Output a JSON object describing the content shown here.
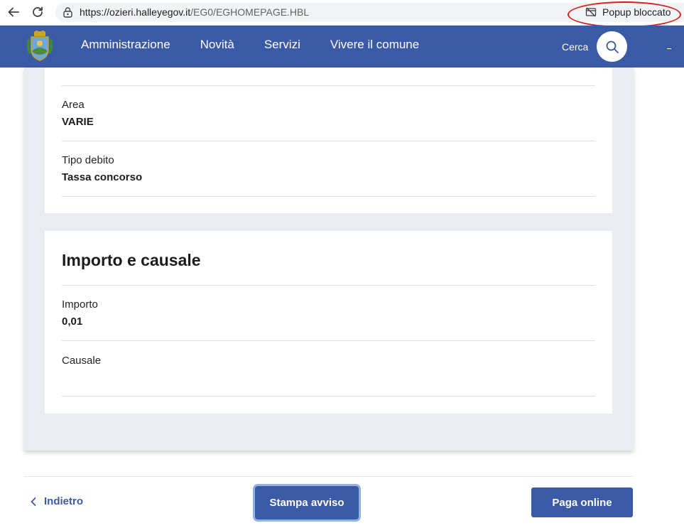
{
  "browser": {
    "url_host": "https://ozieri.halleyegov.it",
    "url_path": "/EG0/EGHOMEPAGE.HBL",
    "popup_blocked_label": "Popup bloccato",
    "icons": [
      "back-arrow-icon",
      "reload-icon",
      "lock-icon",
      "popup-blocked-icon"
    ]
  },
  "header": {
    "menu": [
      "Amministrazione",
      "Novità",
      "Servizi",
      "Vivere il comune"
    ],
    "search_label": "Cerca",
    "brand_color": "#3a5aa5"
  },
  "details": {
    "area_label": "Area",
    "area_value": "VARIE",
    "tipo_label": "Tipo debito",
    "tipo_value": "Tassa concorso"
  },
  "importo_section": {
    "title": "Importo e causale",
    "importo_label": "Importo",
    "importo_value": "0,01",
    "causale_label": "Causale",
    "causale_value": ""
  },
  "footer": {
    "back_label": "Indietro",
    "print_label": "Stampa avviso",
    "pay_label": "Paga online"
  }
}
